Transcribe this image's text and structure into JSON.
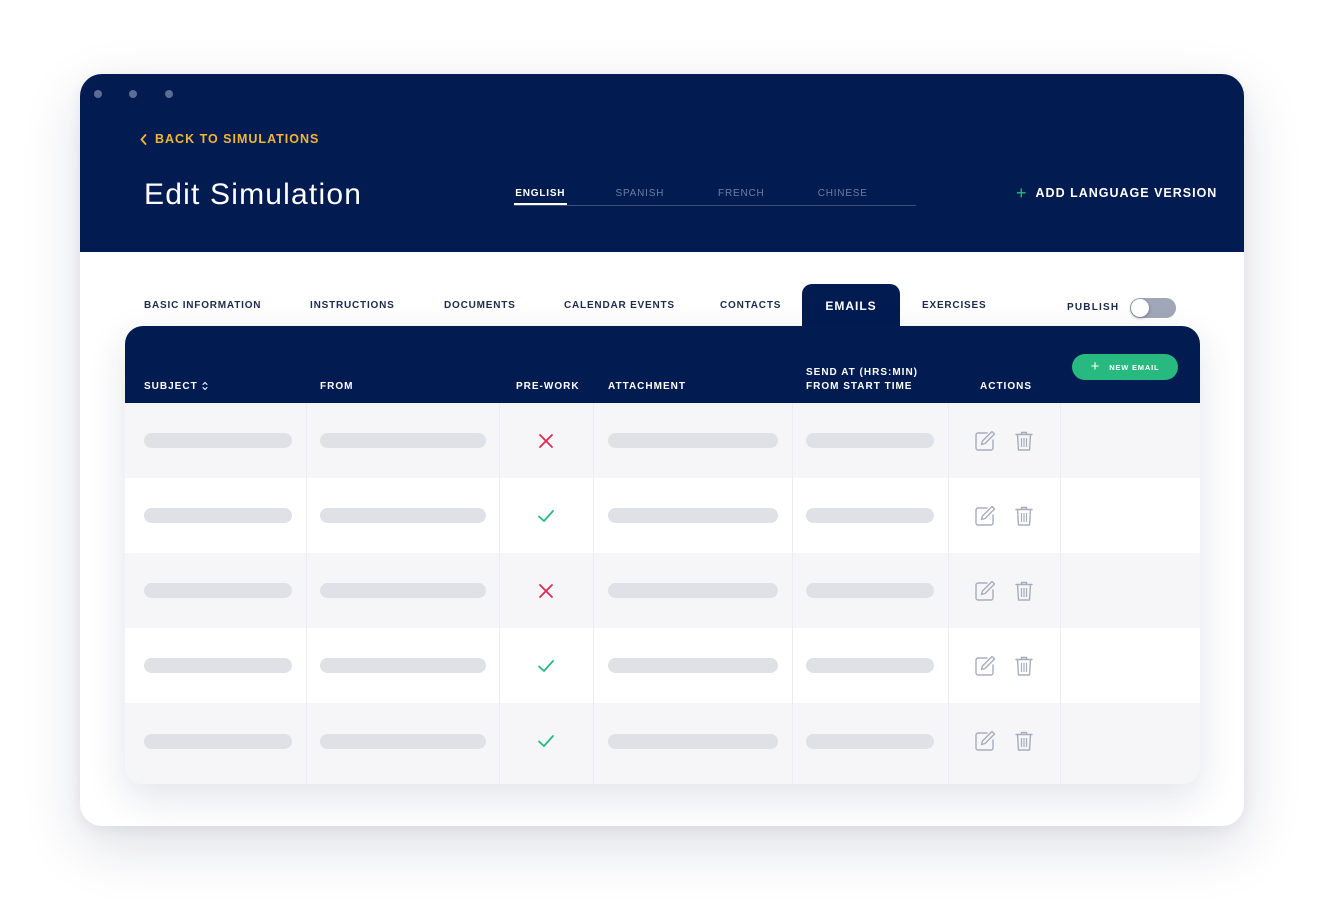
{
  "header": {
    "back_label": "BACK TO SIMULATIONS",
    "title": "Edit Simulation",
    "languages": [
      "ENGLISH",
      "SPANISH",
      "FRENCH",
      "CHINESE"
    ],
    "active_language": "ENGLISH",
    "add_language_label": "ADD LANGUAGE VERSION"
  },
  "tabs": [
    "BASIC INFORMATION",
    "INSTRUCTIONS",
    "DOCUMENTS",
    "CALENDAR EVENTS",
    "CONTACTS",
    "EMAILS",
    "EXERCISES"
  ],
  "active_tab": "EMAILS",
  "publish": {
    "label": "PUBLISH",
    "enabled": false
  },
  "table": {
    "columns": {
      "subject": "SUBJECT",
      "from": "FROM",
      "prework": "PRE-WORK",
      "attachment": "ATTACHMENT",
      "send_at_line1": "SEND AT (HRS:MIN)",
      "send_at_line2": "FROM START TIME",
      "actions": "ACTIONS"
    },
    "new_button_label": "NEW EMAIL",
    "rows": [
      {
        "prework": false
      },
      {
        "prework": true
      },
      {
        "prework": false
      },
      {
        "prework": true
      },
      {
        "prework": true
      }
    ]
  },
  "colors": {
    "navy": "#021c52",
    "accent_yellow": "#f2b632",
    "accent_green": "#27b980",
    "cross_red": "#e0294f",
    "placeholder": "#dfe1e6"
  },
  "icons": {
    "back": "chevron-left-icon",
    "add": "plus-icon",
    "sort": "sort-icon",
    "yes": "check-icon",
    "no": "cross-icon",
    "edit": "edit-icon",
    "delete": "trash-icon"
  }
}
